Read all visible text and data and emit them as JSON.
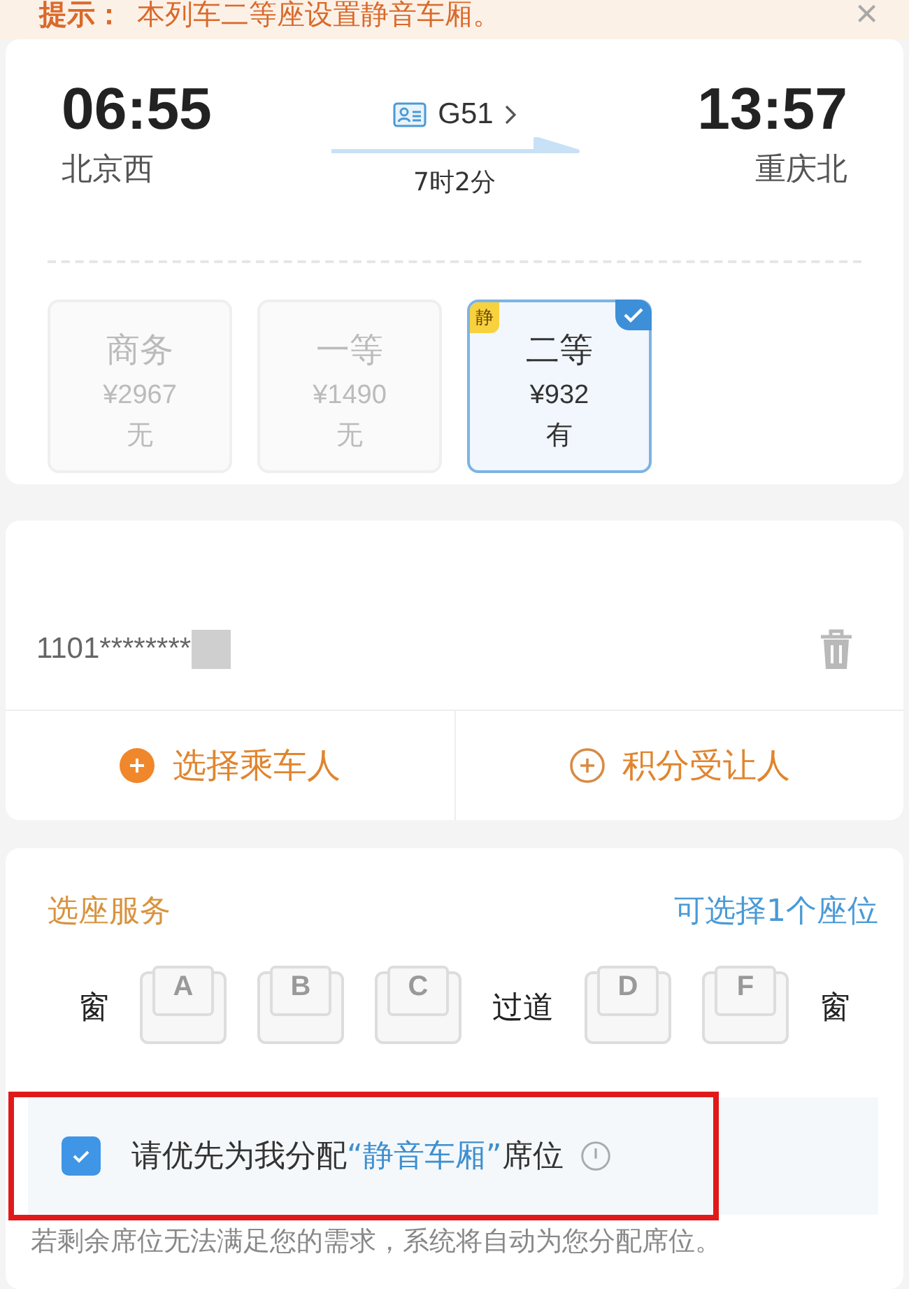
{
  "notice": {
    "label": "提示：",
    "text": "本列车二等座设置静音车厢。",
    "close": "×"
  },
  "trip": {
    "depart_time": "06:55",
    "depart_station": "北京西",
    "train": "G51",
    "duration": "7时2分",
    "arrive_time": "13:57",
    "arrive_station": "重庆北"
  },
  "seat_classes": [
    {
      "name": "商务",
      "price": "¥2967",
      "availability": "无",
      "selected": false,
      "disabled": true
    },
    {
      "name": "一等",
      "price": "¥1490",
      "availability": "无",
      "selected": false,
      "disabled": true
    },
    {
      "name": "二等",
      "price": "¥932",
      "availability": "有",
      "selected": true,
      "disabled": false,
      "badge": "静"
    }
  ],
  "passenger": {
    "id_number": "1101********"
  },
  "actions": [
    {
      "label": "选择乘车人",
      "kind": "filled"
    },
    {
      "label": "积分受让人",
      "kind": "outline"
    }
  ],
  "seat_service": {
    "title": "选座服务",
    "hint": "可选择1个座位",
    "seats": [
      {
        "kind": "label",
        "text": "窗"
      },
      {
        "kind": "seat",
        "text": "A",
        "selected": false
      },
      {
        "kind": "seat",
        "text": "B",
        "selected": false
      },
      {
        "kind": "seat",
        "text": "C",
        "selected": false
      },
      {
        "kind": "label",
        "text": "过道"
      },
      {
        "kind": "seat",
        "text": "D",
        "selected": false
      },
      {
        "kind": "seat",
        "text": "F",
        "selected": false
      },
      {
        "kind": "label",
        "text": "窗"
      }
    ]
  },
  "quiet_option": {
    "checked": true,
    "before": "请优先为我分配",
    "highlight": "“静音车厢”",
    "after": "席位"
  },
  "footnote": "若剩余席位无法满足您的需求，系统将自动为您分配席位。"
}
